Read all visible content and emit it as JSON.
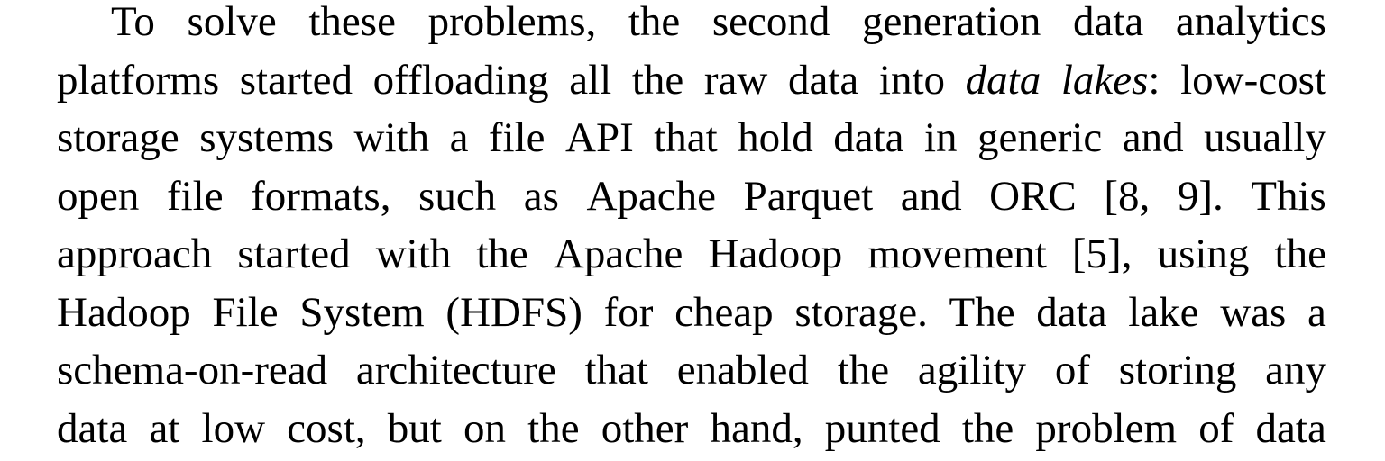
{
  "paragraph": {
    "lines": [
      {
        "parts": [
          {
            "text": "To solve these problems, the second generation data analytics",
            "italic": false
          }
        ]
      },
      {
        "parts": [
          {
            "text": "platforms started offloading all the raw data into ",
            "italic": false
          },
          {
            "text": "data lakes",
            "italic": true
          },
          {
            "text": ": low-cost",
            "italic": false
          }
        ]
      },
      {
        "parts": [
          {
            "text": "storage systems with a file API that hold data in generic and usually",
            "italic": false
          }
        ]
      },
      {
        "parts": [
          {
            "text": "open file formats, such as Apache Parquet and ORC [8, 9]. This",
            "italic": false
          }
        ]
      },
      {
        "parts": [
          {
            "text": "approach started with the Apache Hadoop movement [5], using the",
            "italic": false
          }
        ]
      },
      {
        "parts": [
          {
            "text": "Hadoop File System (HDFS) for cheap storage. The data lake was a",
            "italic": false
          }
        ]
      },
      {
        "parts": [
          {
            "text": "schema-on-read architecture that enabled the agility of storing any",
            "italic": false
          }
        ]
      },
      {
        "parts": [
          {
            "text": "data at low cost, but on the other hand, punted the problem of data",
            "italic": false
          }
        ]
      }
    ]
  }
}
